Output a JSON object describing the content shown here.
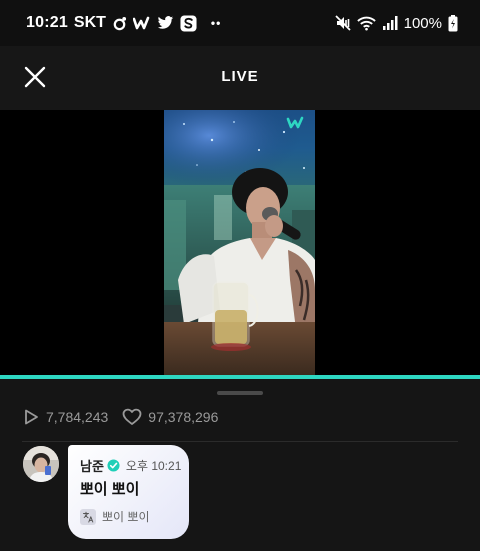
{
  "status_bar": {
    "time": "10:21",
    "carrier": "SKT",
    "battery": "100%",
    "overflow_dots": "••",
    "left_icons": [
      "threads-icon",
      "weverse-icon",
      "twitter-icon",
      "s-app-icon"
    ],
    "right_icons": [
      "mute-vibrate-icon",
      "wifi-icon",
      "signal-icon",
      "battery-icon"
    ]
  },
  "header": {
    "title": "LIVE",
    "close_icon": "close-icon"
  },
  "video": {
    "watermark_icon": "weverse-logo-icon",
    "progress_fraction": 1.0,
    "accent_color": "#2ed7c2"
  },
  "stats": {
    "plays": "7,784,243",
    "likes": "97,378,296",
    "play_icon": "play-icon",
    "like_icon": "heart-icon"
  },
  "comment": {
    "author": "남준",
    "verified_icon": "verified-badge-icon",
    "time": "오후 10:21",
    "text": "뽀이 뽀이",
    "translation": "뽀이 뽀이",
    "translate_icon": "translate-icon"
  }
}
